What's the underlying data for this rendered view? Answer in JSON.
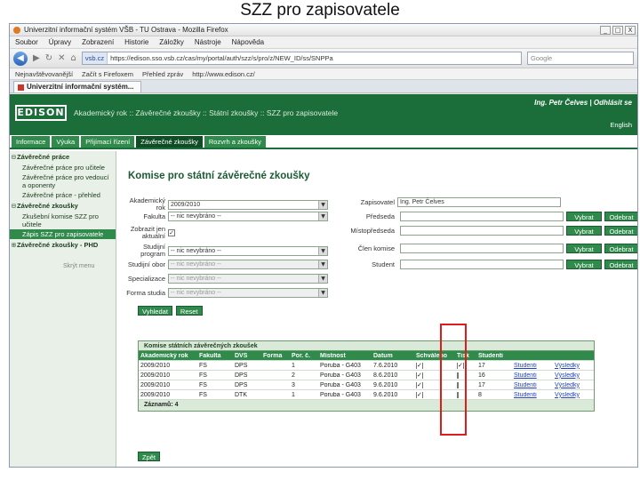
{
  "slide": {
    "title": "SZZ pro zapisovatele"
  },
  "window": {
    "title": "Univerzitní informační systém VŠB - TU Ostrava - Mozilla Firefox",
    "min": "_",
    "max": "□",
    "close": "X"
  },
  "menu": [
    "Soubor",
    "Úpravy",
    "Zobrazení",
    "Historie",
    "Záložky",
    "Nástroje",
    "Nápověda"
  ],
  "nav": {
    "site": "vsb.cz",
    "url": "https://edison.sso.vsb.cz/cas/my/portal/auth/szz/s/pro/z/NEW_ID/ss/SNPPa",
    "search_placeholder": "Google",
    "back": "◀",
    "fwd": "▶",
    "reload": "↻",
    "stop": "✕",
    "home": "⌂"
  },
  "bookmarks": [
    "Nejnavštěvovanější",
    "Začít s Firefoxem",
    "Přehled zpráv",
    "http://www.edison.cz/"
  ],
  "tab": {
    "label": "Univerzitní informační systém..."
  },
  "app": {
    "logo": "EDISON",
    "breadcrumb": "Akademický rok :: Závěrečné zkoušky :: Státní zkoušky :: SZZ pro zapisovatele",
    "user": "Ing. Petr Čelves | Odhlásit se",
    "lang": "English"
  },
  "module_tabs": [
    "Informace",
    "Výuka",
    "Přijímací řízení",
    "Závěrečné zkoušky",
    "Rozvrh a zkoušky"
  ],
  "sidebar": {
    "group1": "Závěrečné práce",
    "items1": [
      "Závěrečné práce pro učitele",
      "Závěrečné práce pro vedoucí a oponenty",
      "Závěrečné práce - přehled"
    ],
    "group2": "Závěrečné zkoušky",
    "items2": [
      "Zkušební komise SZZ pro učitele",
      "Zápis SZZ pro zapisovatele"
    ],
    "group3": "Závěrečné zkoušky - PHD",
    "footer": "Skrýt menu"
  },
  "page": {
    "title": "Komise pro státní závěrečné zkoušky"
  },
  "form": {
    "akad_label": "Akademický rok",
    "akad_value": "2009/2010",
    "fakulta_label": "Fakulta",
    "fakulta_value": "-- nic nevybráno --",
    "zobrazit_label": "Zobrazit jen aktuální",
    "zobrazit_check": "✓",
    "program_label": "Studijní program",
    "program_value": "-- nic nevybráno --",
    "obor_label": "Studijní obor",
    "obor_value": "-- nic nevybráno --",
    "zam_label": "Specializace",
    "zam_value": "-- nic nevybráno --",
    "forma_label": "Forma studia",
    "forma_value": "-- nic nevybráno --",
    "zapisovatel_label": "Zapisovatel",
    "zapisovatel_value": "Ing. Petr Čelves",
    "predseda_label": "Předseda",
    "mistopredseda_label": "Místopředseda",
    "clen_label": "Člen komise",
    "student_label": "Student",
    "vybrat": "Vybrat",
    "odebrat": "Odebrat",
    "vyhledat": "Vyhledat",
    "reset": "Reset"
  },
  "grid": {
    "title": "Komise státních závěrečných zkoušek",
    "headers": [
      "Akademický rok",
      "Fakulta",
      "DVS",
      "Forma",
      "Por. č.",
      "Místnost",
      "Datum",
      "Schváleno",
      "Tisk",
      "Studenti",
      "",
      ""
    ],
    "rows": [
      [
        "2009/2010",
        "FS",
        "DPS",
        "",
        "1",
        "Poruba - G403",
        "7.6.2010",
        "✓",
        "✓",
        "17",
        "Studenti",
        "Výsledky"
      ],
      [
        "2009/2010",
        "FS",
        "DPS",
        "",
        "2",
        "Poruba - G403",
        "8.6.2010",
        "✓",
        "",
        "16",
        "Studenti",
        "Výsledky"
      ],
      [
        "2009/2010",
        "FS",
        "DPS",
        "",
        "3",
        "Poruba - G403",
        "9.6.2010",
        "✓",
        "",
        "17",
        "Studenti",
        "Výsledky"
      ],
      [
        "2009/2010",
        "FS",
        "DTK",
        "",
        "1",
        "Poruba - G403",
        "9.6.2010",
        "✓",
        "",
        "8",
        "Studenti",
        "Výsledky"
      ]
    ],
    "footer": "Záznamů: 4"
  },
  "zpet": "Zpět",
  "colors": {
    "green": "#1b6e3a",
    "red_highlight": "#e01b1b"
  }
}
